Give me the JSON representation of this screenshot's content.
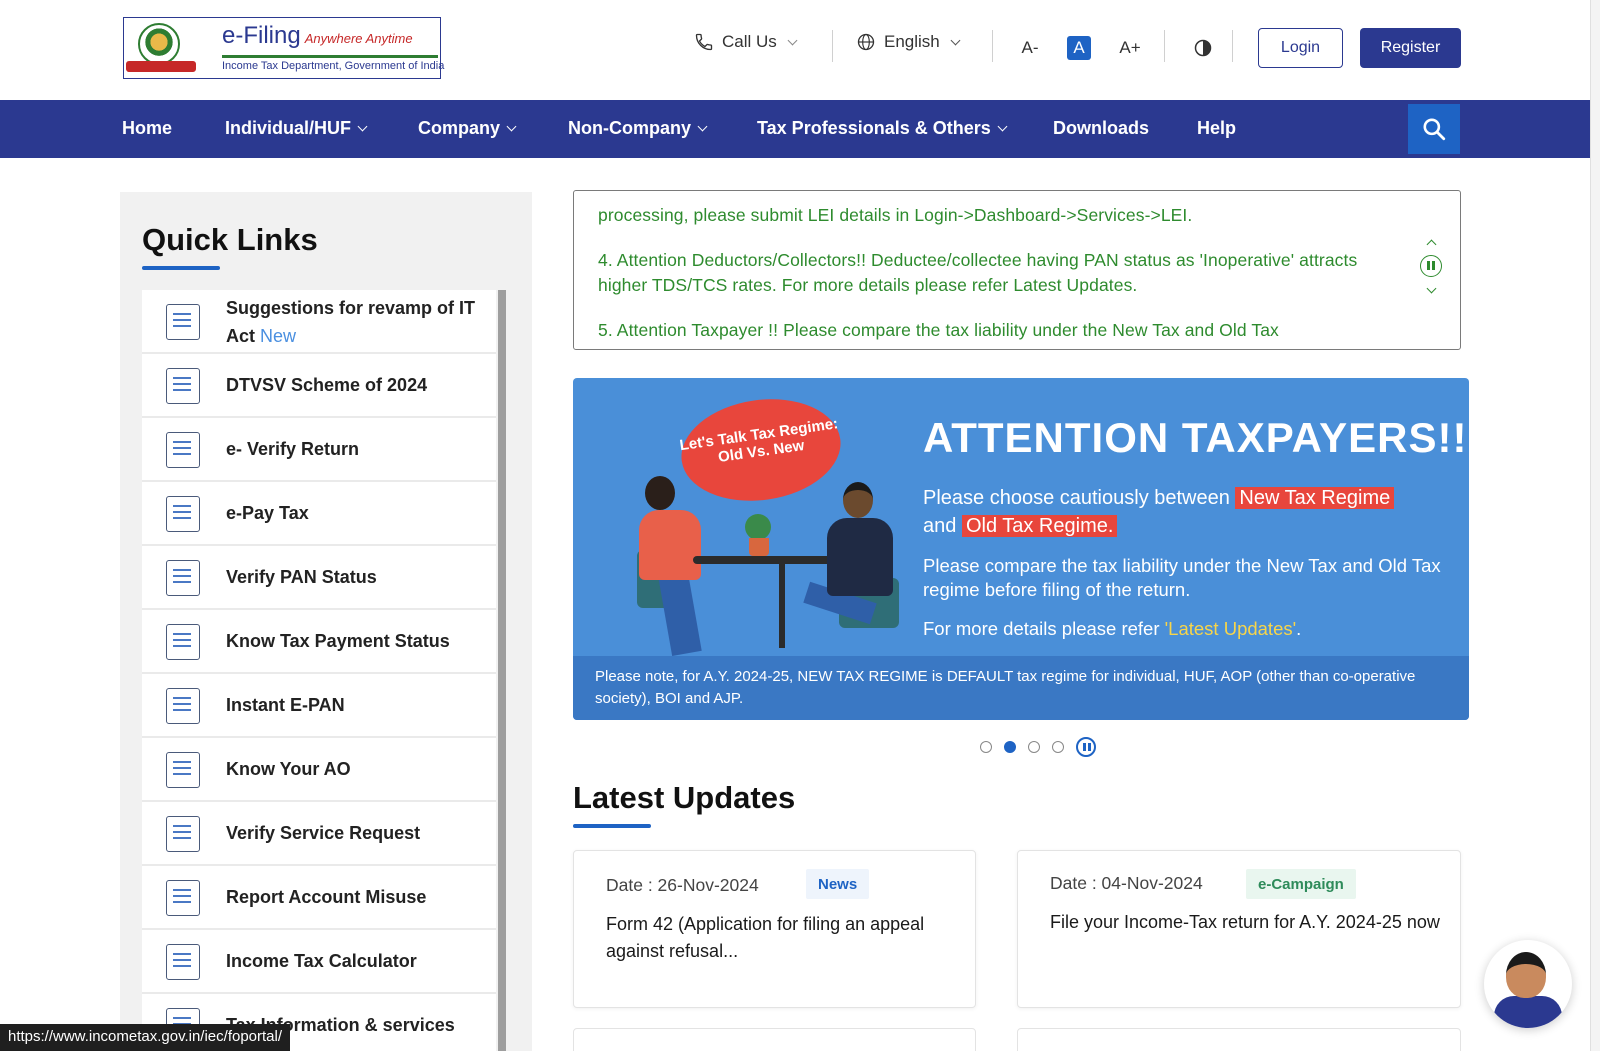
{
  "header": {
    "logo_title": "e-Filing",
    "logo_tagline": "Anywhere Anytime",
    "logo_subtitle": "Income Tax Department, Government of India",
    "call_us": "Call Us",
    "language": "English",
    "font_decrease": "A-",
    "font_normal": "A",
    "font_increase": "A+",
    "login": "Login",
    "register": "Register"
  },
  "nav": {
    "items": [
      {
        "label": "Home"
      },
      {
        "label": "Individual/HUF"
      },
      {
        "label": "Company"
      },
      {
        "label": "Non-Company"
      },
      {
        "label": "Tax Professionals & Others"
      },
      {
        "label": "Downloads"
      },
      {
        "label": "Help"
      }
    ]
  },
  "quick_links": {
    "title": "Quick Links",
    "items": [
      {
        "label": "Suggestions for revamp of IT Act",
        "badge": "New"
      },
      {
        "label": "DTVSV Scheme of 2024"
      },
      {
        "label": "e- Verify Return"
      },
      {
        "label": "e-Pay Tax"
      },
      {
        "label": "Verify PAN Status"
      },
      {
        "label": "Know Tax Payment Status"
      },
      {
        "label": "Instant E-PAN"
      },
      {
        "label": "Know Your AO"
      },
      {
        "label": "Verify Service Request"
      },
      {
        "label": "Report Account Misuse"
      },
      {
        "label": "Income Tax Calculator"
      },
      {
        "label": "Tax Information & services"
      }
    ]
  },
  "ticker": {
    "lines": [
      "processing, please submit LEI details in Login->Dashboard->Services->LEI.",
      "4. Attention Deductors/Collectors!! Deductee/collectee having PAN status as 'Inoperative' attracts higher TDS/TCS rates. For more details please refer Latest Updates.",
      "5. Attention Taxpayer !! Please compare the tax liability under the New Tax and Old Tax"
    ]
  },
  "banner": {
    "bubble": "Let's Talk Tax Regime: Old Vs. New",
    "title": "ATTENTION TAXPAYERS!!",
    "line1_a": "Please choose cautiously between ",
    "line1_hl1": "New Tax Regime",
    "line1_b": "and ",
    "line1_hl2": "Old Tax Regime.",
    "line2": "Please compare the tax liability under the New Tax and Old Tax regime before filing of the return.",
    "line3_a": "For more details please refer ",
    "line3_link": "'Latest Updates'",
    "line3_b": ".",
    "footer": "Please note, for A.Y. 2024-25, NEW TAX REGIME is DEFAULT tax regime for individual, HUF, AOP (other than co-operative society), BOI and AJP.",
    "slides": 4,
    "active_slide": 2
  },
  "latest_updates": {
    "title": "Latest Updates",
    "cards": [
      {
        "date": "Date : 26-Nov-2024",
        "badge": "News",
        "text": "Form 42 (Application for filing an appeal against refusal..."
      },
      {
        "date": "Date : 04-Nov-2024",
        "badge": "e-Campaign",
        "text": "File your Income-Tax return for A.Y. 2024-25 now"
      }
    ]
  },
  "status_bar": {
    "url": "https://www.incometax.gov.in/iec/foportal/"
  },
  "colors": {
    "brand_navy": "#2b3990",
    "accent_blue": "#1e63c4",
    "ticker_green": "#2e8b2e",
    "banner_blue": "#4a8fd8",
    "highlight_red": "#e8463c"
  },
  "icons": [
    "phone-icon",
    "globe-icon",
    "contrast-icon",
    "search-icon",
    "pause-icon",
    "chevron-up-icon",
    "chevron-down-icon"
  ]
}
